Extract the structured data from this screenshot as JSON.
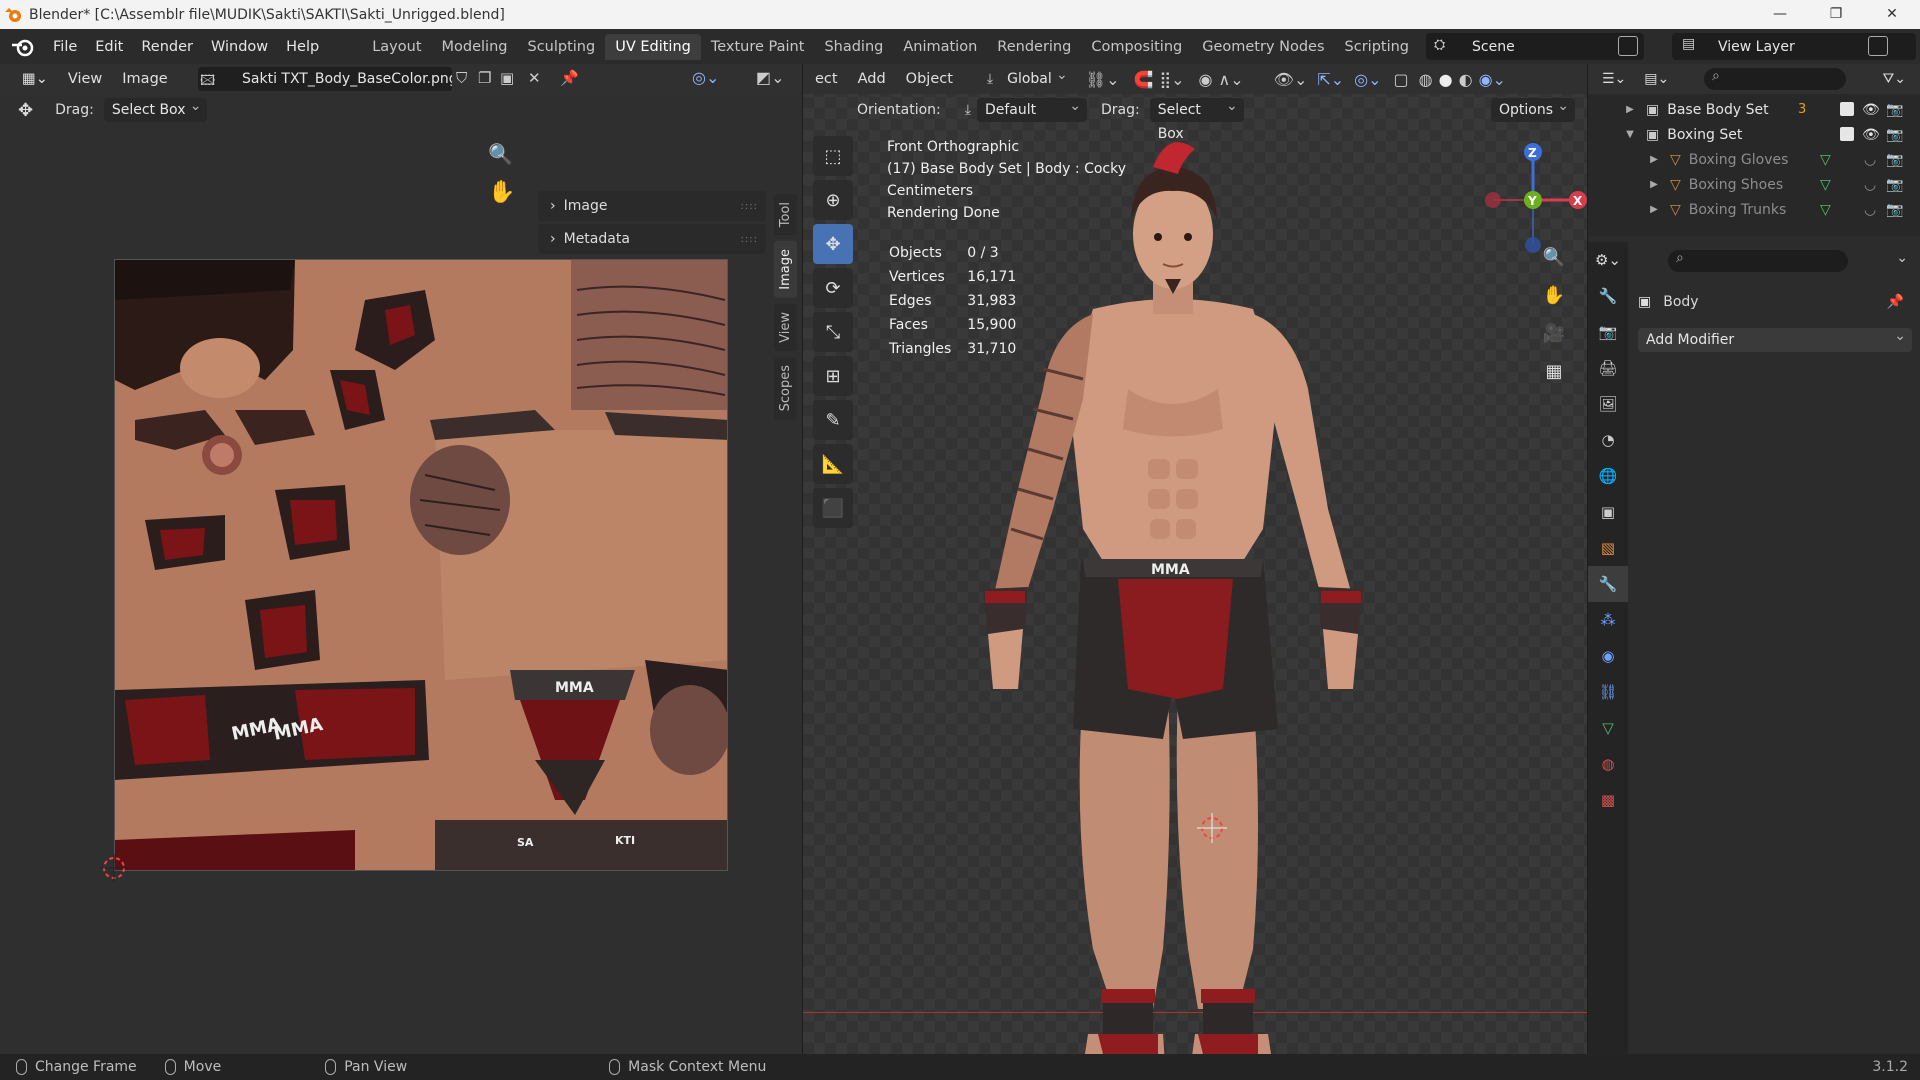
{
  "window": {
    "title": "Blender* [C:\\Assemblr file\\MUDIK\\Sakti\\SAKTI\\Sakti_Unrigged.blend]"
  },
  "menu": [
    "File",
    "Edit",
    "Render",
    "Window",
    "Help"
  ],
  "workspaces": [
    "Layout",
    "Modeling",
    "Sculpting",
    "UV Editing",
    "Texture Paint",
    "Shading",
    "Animation",
    "Rendering",
    "Compositing",
    "Geometry Nodes",
    "Scripting"
  ],
  "active_workspace": "UV Editing",
  "scene": "Scene",
  "view_layer": "View Layer",
  "image_editor": {
    "menus": [
      "View",
      "Image"
    ],
    "image_name": "Sakti TXT_Body_BaseColor.png",
    "drag_label": "Drag:",
    "drag_value": "Select Box",
    "panels": [
      "Image",
      "Metadata"
    ],
    "tabs": [
      "Tool",
      "Image",
      "View",
      "Scopes"
    ],
    "uv_labels": [
      "MMA",
      "SA",
      "KTI"
    ]
  },
  "viewport": {
    "menus": [
      "ect",
      "Add",
      "Object"
    ],
    "transform": "Global",
    "orientation_label": "Orientation:",
    "orientation_value": "Default",
    "drag_label": "Drag:",
    "drag_value": "Select Box",
    "options": "Options",
    "info": {
      "view": "Front Orthographic",
      "object": "(17) Base Body Set | Body : Cocky",
      "units": "Centimeters",
      "status": "Rendering Done"
    },
    "stats": [
      {
        "label": "Objects",
        "value": "0 / 3"
      },
      {
        "label": "Vertices",
        "value": "16,171"
      },
      {
        "label": "Edges",
        "value": "31,983"
      },
      {
        "label": "Faces",
        "value": "15,900"
      },
      {
        "label": "Triangles",
        "value": "31,710"
      }
    ],
    "gizmo": {
      "z": "Z",
      "y": "Y",
      "x": "X"
    },
    "shorts_label": "MMA"
  },
  "outliner": {
    "items": [
      {
        "label": "Base Body Set",
        "badge": "3",
        "level": 0,
        "dim": false
      },
      {
        "label": "Boxing Set",
        "level": 0,
        "dim": false
      },
      {
        "label": "Boxing Gloves",
        "level": 1,
        "dim": true
      },
      {
        "label": "Boxing Shoes",
        "level": 1,
        "dim": true
      },
      {
        "label": "Boxing Trunks",
        "level": 1,
        "dim": true
      }
    ]
  },
  "properties": {
    "object_name": "Body",
    "add_modifier": "Add Modifier"
  },
  "statusbar": {
    "items": [
      "Change Frame",
      "Move",
      "Pan View",
      "Mask Context Menu"
    ],
    "version": "3.1.2"
  }
}
